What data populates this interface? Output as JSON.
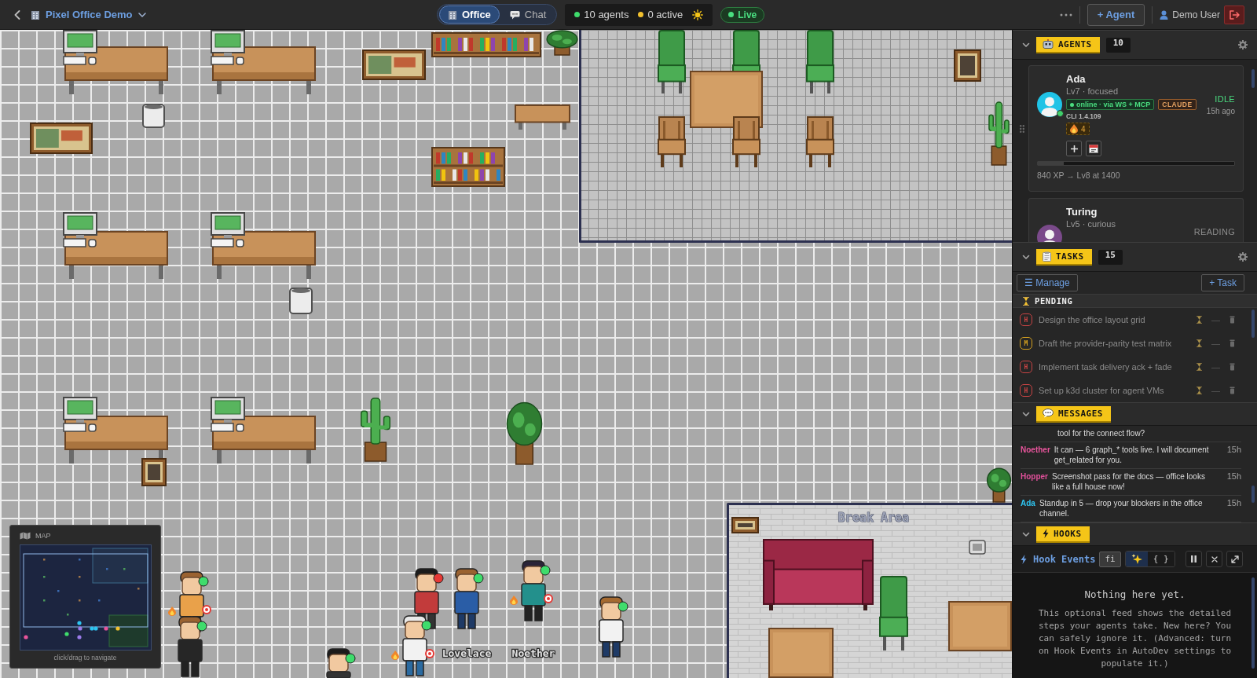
{
  "top_bar": {
    "workspace": "Pixel Office Demo",
    "view_tabs": [
      {
        "kind": "office",
        "label": "Office",
        "selected": true
      },
      {
        "kind": "chat",
        "label": "Chat",
        "selected": false
      }
    ],
    "stats": [
      {
        "label": "10 agents",
        "color": "#3fdc6c"
      },
      {
        "label": "0 active",
        "color": "#f2c12e"
      }
    ],
    "live": "Live",
    "add_agent": "+ Agent",
    "user": "Demo User"
  },
  "office": {
    "rooms": [
      {
        "label": "Break Area"
      }
    ],
    "characters": [
      {
        "color": "#3fdc6c",
        "flame": true,
        "target": true
      },
      {
        "color": "#3fdc6c",
        "flame": false,
        "target": false
      },
      {
        "color": "#e53935",
        "flame": false,
        "target": false
      },
      {
        "color": "#3fdc6c",
        "flame": false,
        "target": false,
        "name": "Lovelace"
      },
      {
        "color": "#3fdc6c",
        "flame": true,
        "target": true
      },
      {
        "color": "#3fdc6c",
        "flame": true,
        "target": true,
        "name": "Noether"
      },
      {
        "color": "#3fdc6c",
        "flame": false,
        "target": false
      },
      {
        "color": "#3fdc6c",
        "flame": false,
        "target": false
      }
    ],
    "minimap": {
      "title": "MAP",
      "hint": "click/drag to navigate"
    }
  },
  "sidebar": {
    "agents": {
      "title": "AGENTS",
      "count": "10",
      "expanded": true,
      "items": [
        {
          "name": "Ada",
          "subtitle": "Lv7 · focused",
          "online": true,
          "connection": "online · via WS + MCP",
          "provider": "CLAUDE",
          "cli": "CLI 1.4.109",
          "streak": "4",
          "status": "IDLE",
          "color": "#4ade80",
          "last_seen": "15h ago",
          "xp": {
            "level": 0.13,
            "label": "840 XP → Lv8 at 1400"
          }
        },
        {
          "name": "Turing",
          "subtitle": "Lv5 · curious",
          "status": "READING",
          "color": "#8c8c8c"
        }
      ]
    },
    "tasks": {
      "title": "TASKS",
      "count": "15",
      "expanded": true,
      "manage": "☰ Manage",
      "add": "+ Task",
      "groups": [
        {
          "title": "PENDING",
          "items": [
            {
              "priority": "H",
              "color": "#c94444",
              "title": "Design the office layout grid",
              "assignee": "—"
            },
            {
              "priority": "M",
              "color": "#d4a020",
              "title": "Draft the provider-parity test matrix",
              "assignee": "—"
            },
            {
              "priority": "H",
              "color": "#c94444",
              "title": "Implement task delivery ack + fade",
              "assignee": "—"
            },
            {
              "priority": "H",
              "color": "#c94444",
              "title": "Set up k3d cluster for agent VMs",
              "assignee": "—"
            }
          ]
        }
      ]
    },
    "messages": {
      "title": "MESSAGES",
      "expanded": true,
      "items": [
        {
          "kind": "continuation",
          "text": "tool for the connect flow?"
        },
        {
          "kind": "message",
          "sender": "Noether",
          "color": "#e8559c",
          "text": "It can — 6 graph_* tools live. I will document get_related for you.",
          "time": "15h"
        },
        {
          "kind": "message",
          "sender": "Hopper",
          "color": "#e0509a",
          "text": "Screenshot pass for the docs — office looks like a full house now!",
          "time": "15h"
        },
        {
          "kind": "message",
          "sender": "Ada",
          "color": "#2ec4f0",
          "text": "Standup in 5 — drop your blockers in the office channel.",
          "time": "15h"
        }
      ]
    },
    "hooks": {
      "title": "HOOKS",
      "expanded": true,
      "feed": {
        "title": "Hook Events",
        "filter": "fi",
        "modes": [
          {
            "kind": "pretty",
            "selected": true
          },
          {
            "kind": "raw",
            "label": "{ }",
            "selected": false
          }
        ],
        "empty_title": "Nothing here yet.",
        "empty_text": "This optional feed shows the detailed steps your agents take. New here? You can safely ignore it. (Advanced: turn on Hook Events in AutoDev settings to populate it.)"
      }
    }
  }
}
